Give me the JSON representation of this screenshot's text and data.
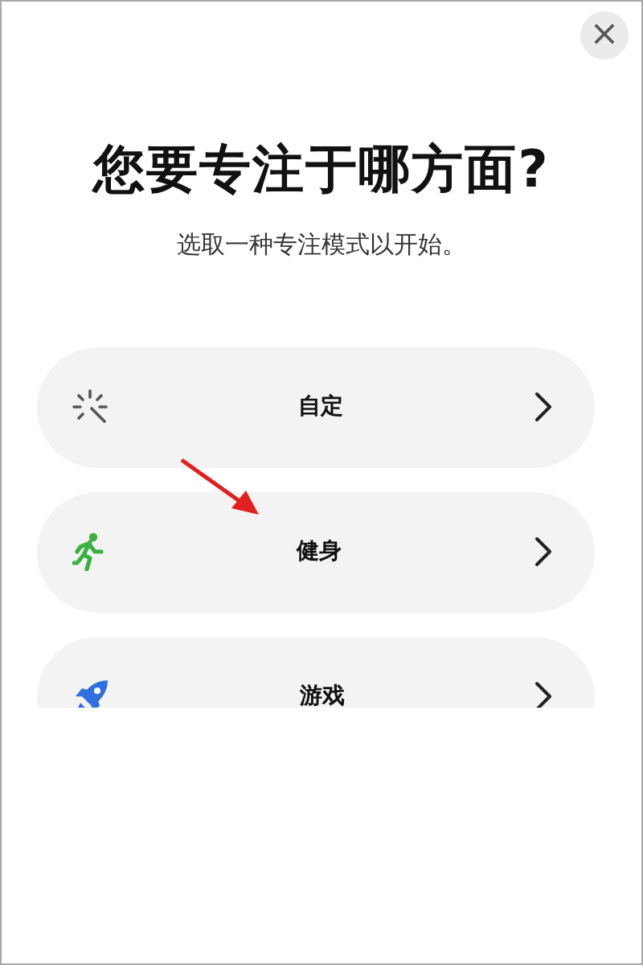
{
  "close_button": {
    "label": "×"
  },
  "title": "您要专注于哪方面?",
  "subtitle": "选取一种专注模式以开始。",
  "modes": [
    {
      "label": "自定",
      "kind": "custom"
    },
    {
      "label": "健身",
      "kind": "fitness"
    },
    {
      "label": "游戏",
      "kind": "gaming"
    }
  ]
}
